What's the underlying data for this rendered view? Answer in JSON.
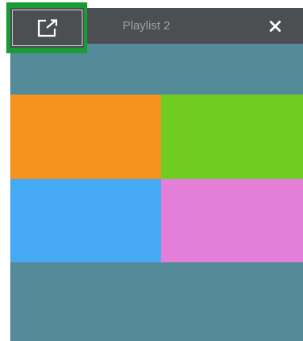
{
  "window": {
    "title": "Playlist 2",
    "popout_icon": "external-link-icon",
    "close_icon": "close-icon"
  },
  "colors": {
    "panel_background": "#558b99",
    "titlebar_background": "#4c4f52",
    "highlight_frame": "#1b9b37"
  },
  "tiles": [
    {
      "name": "orange",
      "color": "#f4941f"
    },
    {
      "name": "green",
      "color": "#6fcd22"
    },
    {
      "name": "blue",
      "color": "#46aaf6"
    },
    {
      "name": "pink",
      "color": "#e47fd7"
    }
  ]
}
